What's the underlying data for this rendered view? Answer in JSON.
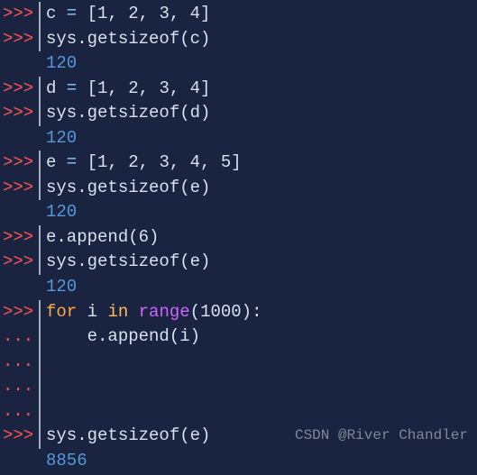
{
  "prompt": ">>>",
  "cont": "...",
  "lines": {
    "l1_var": "c",
    "l1_eq": " = ",
    "l1_list": "[1, 2, 3, 4]",
    "l2_sys": "sys.getsizeof(c)",
    "l3_out": "120",
    "l4_var": "d",
    "l4_eq": " = ",
    "l4_list": "[1, 2, 3, 4]",
    "l5_sys": "sys.getsizeof(d)",
    "l6_out": "120",
    "l7_var": "e",
    "l7_eq": " = ",
    "l7_list": "[1, 2, 3, 4, 5]",
    "l8_sys": "sys.getsizeof(e)",
    "l9_out": "120",
    "l10_call": "e.append(6)",
    "l11_sys": "sys.getsizeof(e)",
    "l12_out": "120",
    "l13_for": "for",
    "l13_i": " i ",
    "l13_in": "in",
    "l13_range": " range",
    "l13_args": "(1000):",
    "l14_body": "    e.append(i)",
    "l18_sys": "sys.getsizeof(e)",
    "l19_out": "8856"
  },
  "watermark": "CSDN @River Chandler"
}
